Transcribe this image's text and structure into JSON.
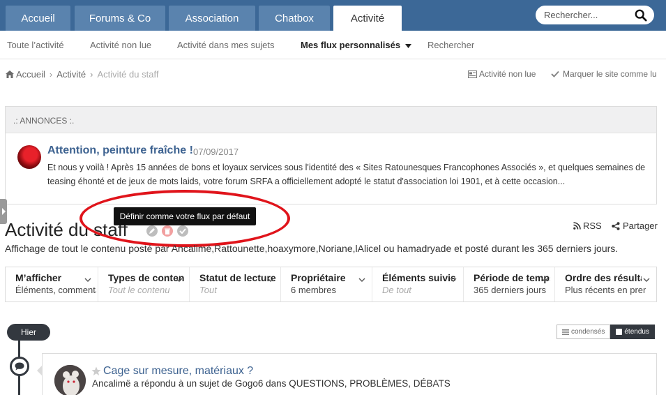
{
  "nav": {
    "tabs": [
      {
        "label": "Accueil"
      },
      {
        "label": "Forums & Co"
      },
      {
        "label": "Association"
      },
      {
        "label": "Chatbox"
      },
      {
        "label": "Activité"
      }
    ],
    "search_placeholder": "Rechercher..."
  },
  "subnav": {
    "items": [
      "Toute l’activité",
      "Activité non lue",
      "Activité dans mes sujets",
      "Mes flux personnalisés",
      "Rechercher"
    ]
  },
  "breadcrumb": {
    "items": [
      "Accueil",
      "Activité",
      "Activité du staff"
    ]
  },
  "quick_links": {
    "unread": "Activité non lue",
    "mark_read": "Marquer le site comme lu"
  },
  "announcement": {
    "header": ".: ANNONCES :.",
    "title": "Attention, peinture fraîche !",
    "date": "07/09/2017",
    "text": "Et nous y voilà ! Après 15 années de bons et loyaux services sous l'identité des « Sites Ratounesques Francophones Associés », et quelques semaines de teasing éhonté et de jeux de mots laids, votre forum SRFA a officiellement adopté le statut d'association loi 1901, et à cette occasion..."
  },
  "page": {
    "title": "Activité du staff",
    "tooltip": "Définir comme votre flux par défaut",
    "rss": "RSS",
    "share": "Partager",
    "description": "Affichage de tout le contenu posté par Ancalimë,Rattounette,hoaxymore,Noriane,lAlicel ou hamadryade et posté durant les 365 derniers jours."
  },
  "filters": [
    {
      "title": "M’afficher",
      "value": "Éléments, commentaires",
      "muted": false
    },
    {
      "title": "Types de contenu",
      "value": "Tout le contenu",
      "muted": true
    },
    {
      "title": "Statut de lecture",
      "value": "Tout",
      "muted": true
    },
    {
      "title": "Propriétaire",
      "value": "6 membres",
      "muted": false
    },
    {
      "title": "Éléments suivis",
      "value": "De tout",
      "muted": true
    },
    {
      "title": "Période de temps",
      "value": "365 derniers jours",
      "muted": false
    },
    {
      "title": "Ordre des résultats",
      "value": "Plus récents en premier",
      "muted": false
    }
  ],
  "timeline": {
    "day_label": "Hier",
    "view_condensed": "condensés",
    "view_expanded": "étendus"
  },
  "activity": {
    "title": "Cage sur mesure, matériaux ?",
    "summary": "Ancalimë a répondu à un sujet de Gogo6 dans QUESTIONS, PROBLÈMES, DÉBATS"
  },
  "colors": {
    "nav_bg": "#3c6897",
    "tab_bg": "#5a83ae",
    "link": "#3d6290",
    "highlight_ring": "#e0141b",
    "timeline_dark": "#33383f"
  }
}
